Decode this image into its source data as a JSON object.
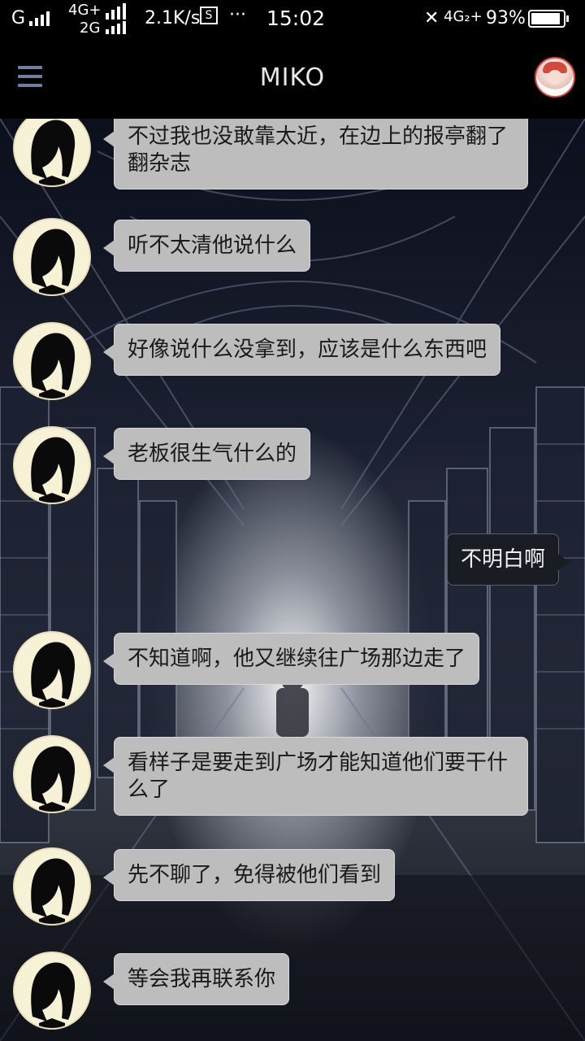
{
  "status_bar": {
    "carrier1": "G",
    "net_top": "4G+",
    "net_bottom": "2G",
    "speed": "2.1K/s",
    "more": "···",
    "time": "15:02",
    "net_right": "4G₂+",
    "battery": "93%",
    "battery_level": 0.93
  },
  "header": {
    "title": "MIKO",
    "menu_icon": "hamburger-menu-icon",
    "avatar_icon": "user-avatar"
  },
  "messages": [
    {
      "from": "other",
      "text": "不过我也没敢靠太近，在边上的报亭翻了翻杂志"
    },
    {
      "from": "other",
      "text": "听不太清他说什么"
    },
    {
      "from": "other",
      "text": "好像说什么没拿到，应该是什么东西吧"
    },
    {
      "from": "other",
      "text": "老板很生气什么的"
    },
    {
      "from": "me",
      "text": "不明白啊"
    },
    {
      "from": "other",
      "text": "不知道啊，他又继续往广场那边走了"
    },
    {
      "from": "other",
      "text": "看样子是要走到广场才能知道他们要干什么了"
    },
    {
      "from": "other",
      "text": "先不聊了，免得被他们看到"
    },
    {
      "from": "other",
      "text": "等会我再联系你"
    }
  ],
  "colors": {
    "bubble_other": "#bdbdbd",
    "bubble_me": "#1a1c24",
    "header_bg": "#000000",
    "menu_icon": "#6d7fa3"
  }
}
